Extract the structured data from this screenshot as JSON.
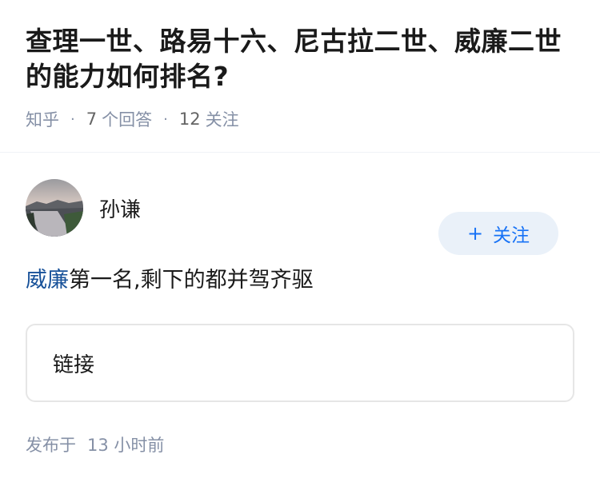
{
  "question": {
    "title": "查理一世、路易十六、尼古拉二世、威廉二世的能力如何排名?",
    "source": "知乎",
    "answers_count": "7",
    "answers_label": "个回答",
    "followers_count": "12",
    "followers_label": "关注"
  },
  "answer": {
    "author": {
      "name": "孙谦",
      "avatar_icon": "avatar-landscape-photo"
    },
    "follow_button": {
      "plus": "+",
      "label": "关注"
    },
    "content": {
      "link_text": "威廉",
      "rest_text": "第一名,剩下的都并驾齐驱"
    },
    "link_card_label": "链接",
    "published_label": "发布于",
    "published_time": "13 小时前"
  },
  "colors": {
    "accent": "#1772f6",
    "link": "#175199",
    "meta": "#8590a6",
    "follow_bg": "#eaf1f9"
  }
}
